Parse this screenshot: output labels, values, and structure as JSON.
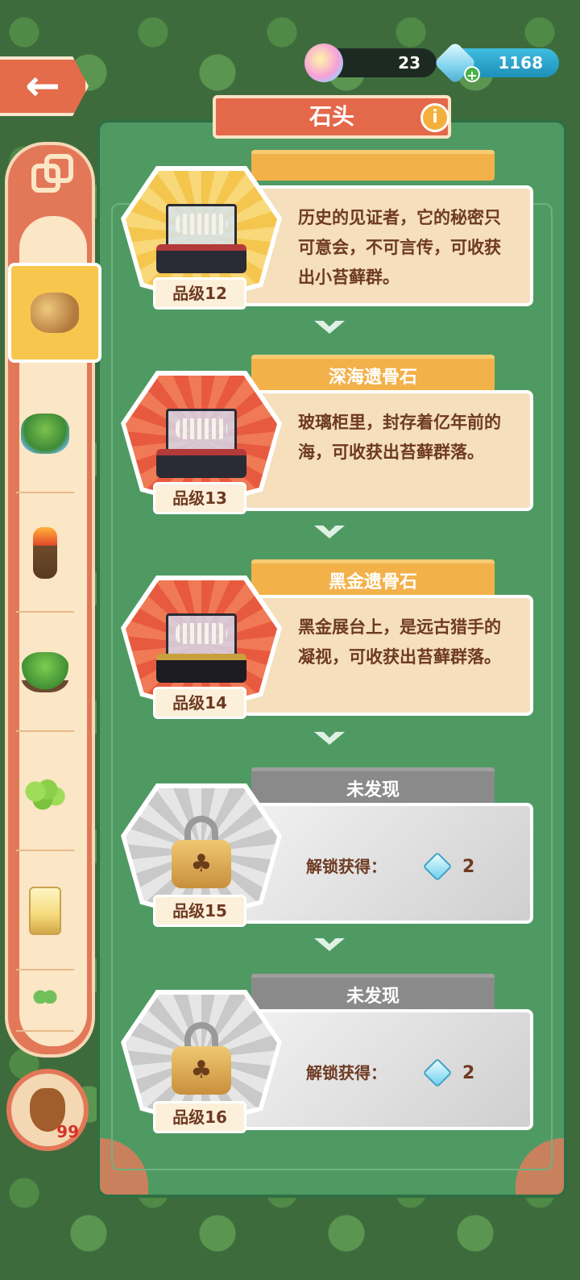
{
  "header": {
    "title": "石头",
    "info_label": "i",
    "back_label": "←"
  },
  "resources": {
    "cloud_count": "23",
    "gem_count": "1168",
    "gem_plus": "+"
  },
  "sidebar": {
    "categories": [
      "rock",
      "pond",
      "torch",
      "tree",
      "grape",
      "lamp",
      "sprout"
    ],
    "active_index": 0
  },
  "hand_counter": "99",
  "items": [
    {
      "name": "",
      "grade": "品级12",
      "description": "历史的见证者，它的秘密只可意会，不可言传，可收获出小苔藓群。",
      "locked": false,
      "frame": "gold"
    },
    {
      "name": "深海遗骨石",
      "grade": "品级13",
      "description": "玻璃柜里，封存着亿年前的海，可收获出苔藓群落。",
      "locked": false,
      "frame": "red"
    },
    {
      "name": "黑金遗骨石",
      "grade": "品级14",
      "description": "黑金展台上，是远古猎手的凝视，可收获出苔藓群落。",
      "locked": false,
      "frame": "red"
    },
    {
      "name": "未发现",
      "grade": "品级15",
      "unlock_label": "解锁获得：",
      "unlock_cost": "2",
      "locked": true
    },
    {
      "name": "未发现",
      "grade": "品级16",
      "unlock_label": "解锁获得：",
      "unlock_cost": "2",
      "locked": true
    }
  ],
  "colors": {
    "panel_green": "#4f9a63",
    "title_red": "#e4684a",
    "name_orange": "#f3b14a",
    "locked_gray": "#8a8a8a",
    "text_brown": "#6e3a22"
  }
}
